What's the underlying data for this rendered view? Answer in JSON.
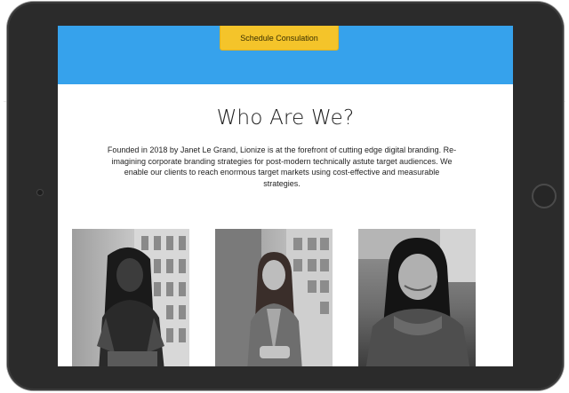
{
  "hero": {
    "cta_label": "Schedule Consulation"
  },
  "about": {
    "title": "Who Are We?",
    "body": "Founded in 2018 by Janet Le Grand, Lionize is at the forefront of cutting edge digital branding. Re-imagining corporate branding strategies for post-modern technically astute target audiences. We enable our clients to reach enormous target markets using cost-effective and measurable strategies."
  },
  "team_photos": [
    {
      "icon": "team-member-photo-1"
    },
    {
      "icon": "team-member-photo-2"
    },
    {
      "icon": "team-member-photo-3"
    }
  ],
  "colors": {
    "hero_band": "#36a2ec",
    "cta_button": "#f4c42a",
    "device_frame": "#2b2b2b",
    "text": "#1f1f1f"
  }
}
